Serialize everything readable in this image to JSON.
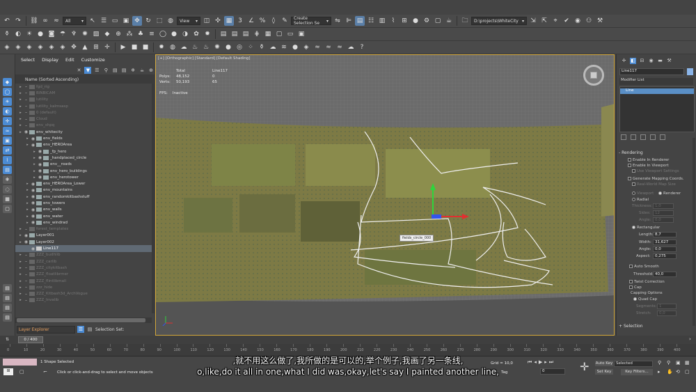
{
  "toolbar": {
    "selection_filter": "All",
    "view_dropdown": "View",
    "create_selection_set": "Create Selection Se",
    "project_path": "D:\\projects\\WhiteCity"
  },
  "explorer": {
    "menu": [
      "Select",
      "Display",
      "Edit",
      "Customize"
    ],
    "column_header": "Name (Sorted Ascending)",
    "rows": [
      {
        "label": "fgd_rig",
        "dim": true,
        "indent": 0
      },
      {
        "label": "BINBICAM",
        "dim": true,
        "indent": 0
      },
      {
        "label": "lutility",
        "dim": true,
        "indent": 0
      },
      {
        "label": "lutility_kalmsasp",
        "dim": true,
        "indent": 0
      },
      {
        "label": "0 (default)",
        "dim": true,
        "indent": 0
      },
      {
        "label": "Cloud",
        "dim": true,
        "indent": 0
      },
      {
        "label": "env_shpq",
        "dim": true,
        "indent": 0
      },
      {
        "label": "env_whitecity",
        "dim": false,
        "indent": 0
      },
      {
        "label": "env_fields",
        "dim": false,
        "indent": 1
      },
      {
        "label": "env_HEROArea",
        "dim": false,
        "indent": 1
      },
      {
        "label": "_fp_hero",
        "dim": false,
        "indent": 2
      },
      {
        "label": "_handplaced_circle",
        "dim": false,
        "indent": 2
      },
      {
        "label": "env__roads",
        "dim": false,
        "indent": 2
      },
      {
        "label": "env_hero_buildings",
        "dim": false,
        "indent": 2
      },
      {
        "label": "env_herotower",
        "dim": false,
        "indent": 2
      },
      {
        "label": "env_HEROArea_Lower",
        "dim": false,
        "indent": 1
      },
      {
        "label": "env_mountains",
        "dim": false,
        "indent": 1
      },
      {
        "label": "env_randomkitbashstuff",
        "dim": false,
        "indent": 1
      },
      {
        "label": "env_towers",
        "dim": false,
        "indent": 1
      },
      {
        "label": "env_walls",
        "dim": false,
        "indent": 1
      },
      {
        "label": "env_water",
        "dim": false,
        "indent": 1
      },
      {
        "label": "env_windrad",
        "dim": false,
        "indent": 1
      },
      {
        "label": "forest_templates",
        "dim": true,
        "indent": 0
      },
      {
        "label": "Layer001",
        "dim": false,
        "indent": 0
      },
      {
        "label": "Layer002",
        "dim": false,
        "indent": 0
      },
      {
        "label": "Line117",
        "dim": false,
        "indent": 1,
        "selected": true
      },
      {
        "label": "ZZZ_budhlib",
        "dim": true,
        "indent": 0
      },
      {
        "label": "ZZZ_carlib",
        "dim": true,
        "indent": 0
      },
      {
        "label": "ZZZ_citykitbash",
        "dim": true,
        "indent": 0
      },
      {
        "label": "ZZZ_floatlibrmer",
        "dim": true,
        "indent": 0
      },
      {
        "label": "ZZZ_flintlibmall",
        "dim": true,
        "indent": 0
      },
      {
        "label": "zzz_hide",
        "dim": true,
        "indent": 0
      },
      {
        "label": "ZZZ_Kitbash3d_ArchVogue",
        "dim": true,
        "indent": 0
      },
      {
        "label": "ZZZ_Invalib",
        "dim": true,
        "indent": 0
      }
    ],
    "layer_explorer": "Layer Explorer",
    "selection_set_label": "Selection Set:"
  },
  "viewport": {
    "label": "[+] [Orthographic] [Standard] [Default Shading]",
    "stats_total": "Total",
    "stats_obj": "Line117",
    "polys_label": "Polys:",
    "polys_total": "48,152",
    "polys_obj": "0",
    "verts_label": "Verts:",
    "verts_total": "50,193",
    "verts_obj": "65",
    "fps_label": "FPS:",
    "fps_value": "Inactive",
    "object_label": "fields_circle_000"
  },
  "command_panel": {
    "object_name": "Line117",
    "modifier_list": "Modifier List",
    "stack_item": "Line",
    "rendering_header": "Rendering",
    "enable_in_renderer": "Enable In Renderer",
    "enable_in_viewport": "Enable In Viewport",
    "use_viewport_settings": "Use Viewport Settings",
    "generate_mapping": "Generate Mapping Coords.",
    "real_world_map_size": "Real-World Map Size",
    "viewport_radio": "Viewport",
    "renderer_radio": "Renderer",
    "radial": "Radial",
    "thickness_label": "Thickness:",
    "thickness_value": "1,0",
    "sides_label": "Sides:",
    "sides_value": "12",
    "angle_label_radial": "Angle:",
    "angle_value_radial": "0,0",
    "rectangular": "Rectangular",
    "length_label": "Length:",
    "length_value": "8,7",
    "width_label": "Width:",
    "width_value": "31,627",
    "angle_label": "Angle:",
    "angle_value": "0,0",
    "aspect_label": "Aspect:",
    "aspect_value": "0,275",
    "auto_smooth": "Auto Smooth",
    "threshold_label": "Threshold:",
    "threshold_value": "40,0",
    "twist_correction": "Twist Correction",
    "cap": "Cap",
    "capping_options": "Capping Options",
    "quad_cap": "Quad Cap",
    "segments_label": "Segments:",
    "segments_value": "1",
    "stretch_label": "Stretch:",
    "stretch_value": "0,0",
    "selection_header": "Selection"
  },
  "timeline": {
    "slider": "0 / 400",
    "ticks": [
      "0",
      "10",
      "20",
      "30",
      "40",
      "50",
      "60",
      "70",
      "80",
      "90",
      "100",
      "110",
      "120",
      "130",
      "140",
      "150",
      "160",
      "170",
      "180",
      "190",
      "200",
      "210",
      "220",
      "230",
      "240",
      "250",
      "260",
      "270",
      "280",
      "290",
      "300",
      "310",
      "320",
      "330",
      "340",
      "350",
      "360",
      "370",
      "380",
      "390",
      "400"
    ]
  },
  "status": {
    "shape_selected": "1 Shape Selected",
    "prompt": "Click or click-and-drag to select and move objects",
    "grid": "Grid = 10,0",
    "add_time_tag": "Tag",
    "frame_value": "0",
    "auto_key": "Auto Key",
    "set_key": "Set Key",
    "selected": "Selected",
    "key_filters": "Key Filters..."
  },
  "subtitles": {
    "chinese": ",就不用这么做了,我所做的是可以的,举个例子,我画了另一条线,",
    "english": "o,like,do it all in one,what I did was,okay,let's say I painted another line,"
  }
}
